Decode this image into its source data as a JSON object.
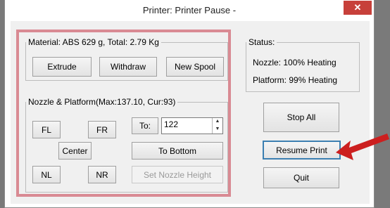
{
  "window": {
    "title": "Printer: Printer Pause -",
    "close_symbol": "✕"
  },
  "material": {
    "legend": "Material: ABS 629 g,  Total: 2.79 Kg",
    "extrude_label": "Extrude",
    "withdraw_label": "Withdraw",
    "new_spool_label": "New Spool"
  },
  "nozzle_platform": {
    "legend": "Nozzle & Platform(Max:137.10, Cur:93)",
    "fl_label": "FL",
    "fr_label": "FR",
    "to_label": "To:",
    "to_value": "122",
    "center_label": "Center",
    "to_bottom_label": "To Bottom",
    "nl_label": "NL",
    "nr_label": "NR",
    "set_nozzle_height_label": "Set Nozzle Height"
  },
  "status": {
    "legend": "Status:",
    "nozzle": "Nozzle: 100%  Heating",
    "platform": "Platform: 99%  Heating"
  },
  "actions": {
    "stop_all_label": "Stop All",
    "resume_print_label": "Resume Print",
    "quit_label": "Quit"
  },
  "colors": {
    "highlight": "#d98a93",
    "close": "#c7403a",
    "pointer_arrow": "#cc1f1f"
  },
  "icons": {
    "close": "close-icon",
    "spin_up": "chevron-up-icon",
    "spin_down": "chevron-down-icon",
    "pointer": "red-arrow-pointer"
  }
}
